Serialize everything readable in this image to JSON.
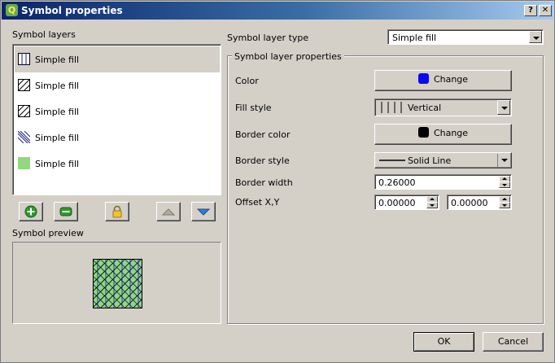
{
  "window": {
    "title": "Symbol properties",
    "help_label": "?",
    "close_label": "✕"
  },
  "left": {
    "layers_title": "Symbol layers",
    "preview_title": "Symbol preview",
    "layers": [
      {
        "label": "Simple fill",
        "pattern": "vertical",
        "selected": true
      },
      {
        "label": "Simple fill",
        "pattern": "diagonal-b"
      },
      {
        "label": "Simple fill",
        "pattern": "diagonal-b"
      },
      {
        "label": "Simple fill",
        "pattern": "diagonal-f"
      },
      {
        "label": "Simple fill",
        "pattern": "solid",
        "color": "#90d77d"
      }
    ],
    "buttons": {
      "add_icon": "plus-icon",
      "remove_icon": "minus-icon",
      "lock_icon": "lock-icon",
      "up_icon": "arrow-up-icon",
      "down_icon": "arrow-down-icon"
    }
  },
  "right": {
    "layer_type_label": "Symbol layer type",
    "layer_type_value": "Simple fill",
    "group_title": "Symbol layer properties",
    "color_label": "Color",
    "color_button": "Change",
    "color_value": "#0a0aee",
    "fill_style_label": "Fill style",
    "fill_style_value": "Vertical",
    "border_color_label": "Border color",
    "border_color_button": "Change",
    "border_color_value": "#000000",
    "border_style_label": "Border style",
    "border_style_value": "Solid Line",
    "border_width_label": "Border width",
    "border_width_value": "0.26000",
    "offset_label": "Offset X,Y",
    "offset_x": "0.00000",
    "offset_y": "0.00000"
  },
  "footer": {
    "ok": "OK",
    "cancel": "Cancel"
  }
}
